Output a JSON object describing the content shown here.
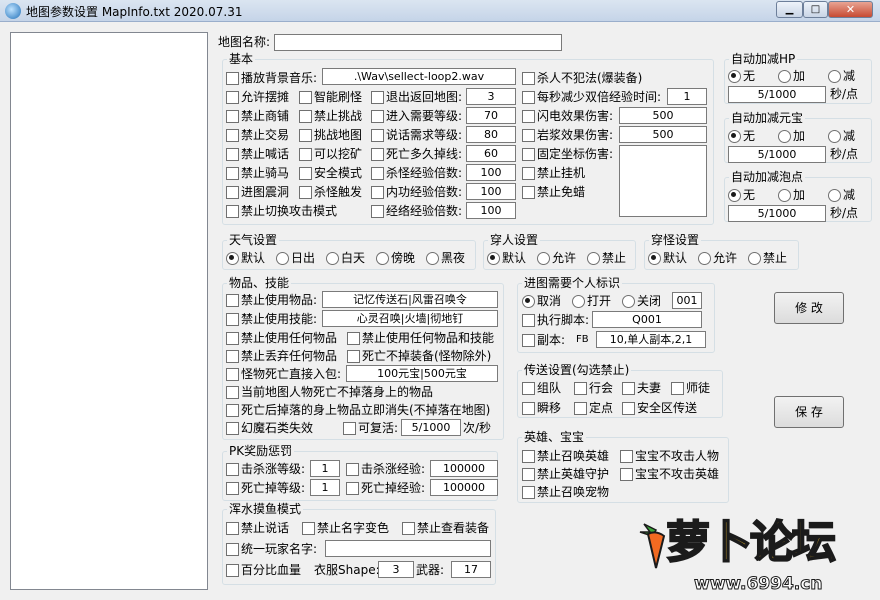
{
  "window": {
    "title": "地图参数设置 MapInfo.txt  2020.07.31",
    "min": "▁",
    "max": "□",
    "close": "✕"
  },
  "map_name": {
    "label": "地图名称:",
    "value": ""
  },
  "basic": {
    "caption": "基本",
    "bgm": {
      "label": "播放背景音乐:",
      "value": ".\\Wav\\sellect-loop2.wav"
    },
    "checks": {
      "allow_stall": "允许摆摊",
      "smart_refresh": "智能刷怪",
      "exit_map": "退出返回地图:",
      "ban_shop": "禁止商铺",
      "ban_challenge": "禁止挑战",
      "enter_level": "进入需要等级:",
      "ban_trade": "禁止交易",
      "challenge_map": "挑战地图",
      "talk_level": "说话需求等级:",
      "ban_shout": "禁止喊话",
      "can_mine": "可以挖矿",
      "death_drop": "死亡多久掉线:",
      "ban_ride": "禁止骑马",
      "safe_mode": "安全模式",
      "kill_exp": "杀怪经验倍数:",
      "into_cave": "进图震洞",
      "kill_trigger": "杀怪触发",
      "inner_exp": "内功经验倍数:",
      "ban_attack_switch": "禁止切换攻击模式",
      "meridian_exp": "经络经验倍数:",
      "no_crime": "杀人不犯法(爆装备)",
      "double_exp": "每秒减少双倍经验时间:",
      "lightning": "闪电效果伤害:",
      "lava": "岩浆效果伤害:",
      "fixed_dmg": "固定坐标伤害:",
      "ban_hang": "禁止挂机",
      "ban_dart": "禁止免蜡"
    },
    "values": {
      "exit_map": "3",
      "enter_level": "70",
      "talk_level": "80",
      "death_drop": "60",
      "kill_exp": "100",
      "inner_exp": "100",
      "meridian_exp": "100",
      "double_exp": "1",
      "lightning": "500",
      "lava": "500"
    }
  },
  "auto_hp": {
    "caption": "自动加减HP",
    "none": "无",
    "add": "加",
    "sub": "减",
    "value": "5/1000",
    "unit": "秒/点"
  },
  "auto_yb": {
    "caption": "自动加减元宝",
    "none": "无",
    "add": "加",
    "sub": "减",
    "value": "5/1000",
    "unit": "秒/点"
  },
  "auto_pp": {
    "caption": "自动加减泡点",
    "none": "无",
    "add": "加",
    "sub": "减",
    "value": "5/1000",
    "unit": "秒/点"
  },
  "weather": {
    "caption": "天气设置",
    "opts": [
      "默认",
      "日出",
      "白天",
      "傍晚",
      "黑夜"
    ]
  },
  "wear_person": {
    "caption": "穿人设置",
    "opts": [
      "默认",
      "允许",
      "禁止"
    ]
  },
  "wear_monster": {
    "caption": "穿怪设置",
    "opts": [
      "默认",
      "允许",
      "禁止"
    ]
  },
  "items": {
    "caption": "物品、技能",
    "ban_use_item": "禁止使用物品:",
    "ban_use_item_val": "记忆传送石|风雷召唤令",
    "ban_use_skill": "禁止使用技能:",
    "ban_use_skill_val": "心灵召唤|火墙|彻地钉",
    "ban_any_item": "禁止使用任何物品",
    "ban_any_item_skill": "禁止使用任何物品和技能",
    "ban_discard": "禁止丢弃任何物品",
    "no_drop_equip": "死亡不掉装备(怪物除外)",
    "monster_bag": "怪物死亡直接入包:",
    "monster_bag_val": "100元宝|500元宝",
    "no_drop_body": "当前地图人物死亡不掉落身上的物品",
    "drop_vanish": "死亡后掉落的身上物品立即消失(不掉落在地图)",
    "magic_lose": "幻魔石类失效",
    "revive": "可复活:",
    "revive_val": "5/1000",
    "revive_unit": "次/秒"
  },
  "pk": {
    "caption": "PK奖励惩罚",
    "kill_lv": "击杀涨等级:",
    "kill_lv_val": "1",
    "kill_exp": "击杀涨经验:",
    "kill_exp_val": "100000",
    "death_lv": "死亡掉等级:",
    "death_lv_val": "1",
    "death_exp": "死亡掉经验:",
    "death_exp_val": "100000"
  },
  "fish": {
    "caption": "浑水摸鱼模式",
    "ban_talk": "禁止说话",
    "ban_name_color": "禁止名字变色",
    "ban_view_equip": "禁止查看装备",
    "unify_name": "统一玩家名字:",
    "unify_name_val": "",
    "pct_hp": "百分比血量",
    "clothes": "衣服Shape:",
    "clothes_val": "3",
    "weapon": "武器:",
    "weapon_val": "17"
  },
  "personal": {
    "caption": "进图需要个人标识",
    "cancel": "取消",
    "open": "打开",
    "close": "关闭",
    "id_val": "001",
    "run_script": "执行脚本:",
    "script_val": "Q001",
    "dungeon": "副本:",
    "fb": "FB",
    "fb_val": "10,单人副本,2,1"
  },
  "teleport": {
    "caption": "传送设置(勾选禁止)",
    "opts": [
      "组队",
      "行会",
      "夫妻",
      "师徒",
      "瞬移",
      "定点",
      "安全区传送"
    ]
  },
  "hero": {
    "caption": "英雄、宝宝",
    "ban_summon_hero": "禁止召唤英雄",
    "pet_no_attack_player": "宝宝不攻击人物",
    "ban_hero_guard": "禁止英雄守护",
    "pet_no_attack_hero": "宝宝不攻击英雄",
    "ban_summon_pet": "禁止召唤宠物"
  },
  "buttons": {
    "modify": "修 改",
    "save": "保 存"
  },
  "watermark": {
    "text": "萝卜论坛",
    "url": "www.6994.cn"
  }
}
